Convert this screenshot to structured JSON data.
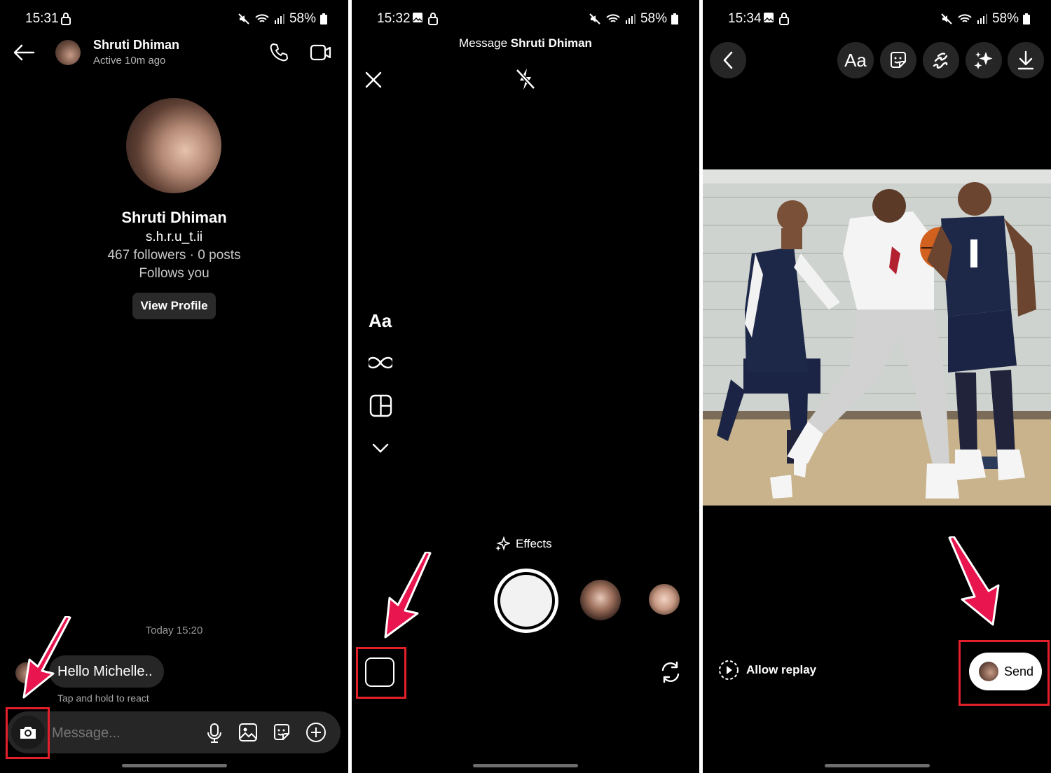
{
  "panel1": {
    "status_time": "15:31",
    "battery": "58%",
    "header": {
      "name": "Shruti Dhiman",
      "active": "Active 10m ago"
    },
    "profile": {
      "name": "Shruti Dhiman",
      "username": "s.h.r.u_t.ii",
      "stats": "467 followers · 0 posts",
      "follows": "Follows you",
      "view_profile_label": "View Profile"
    },
    "timestamp": "Today 15:20",
    "message": {
      "text": "Hello Michelle..",
      "hint": "Tap and hold to react"
    },
    "composer": {
      "placeholder": "Message..."
    }
  },
  "panel2": {
    "status_time": "15:32",
    "battery": "58%",
    "title_prefix": "Message",
    "title_name": "Shruti Dhiman",
    "tools": {
      "text_label": "Aa"
    },
    "effects_label": "Effects"
  },
  "panel3": {
    "status_time": "15:34",
    "battery": "58%",
    "top_tools": {
      "text_label": "Aa"
    },
    "allow_replay_label": "Allow replay",
    "send_label": "Send"
  },
  "colors": {
    "annotation_red": "#e3202a",
    "arrow_pink": "#e8154f",
    "background": "#000000"
  }
}
